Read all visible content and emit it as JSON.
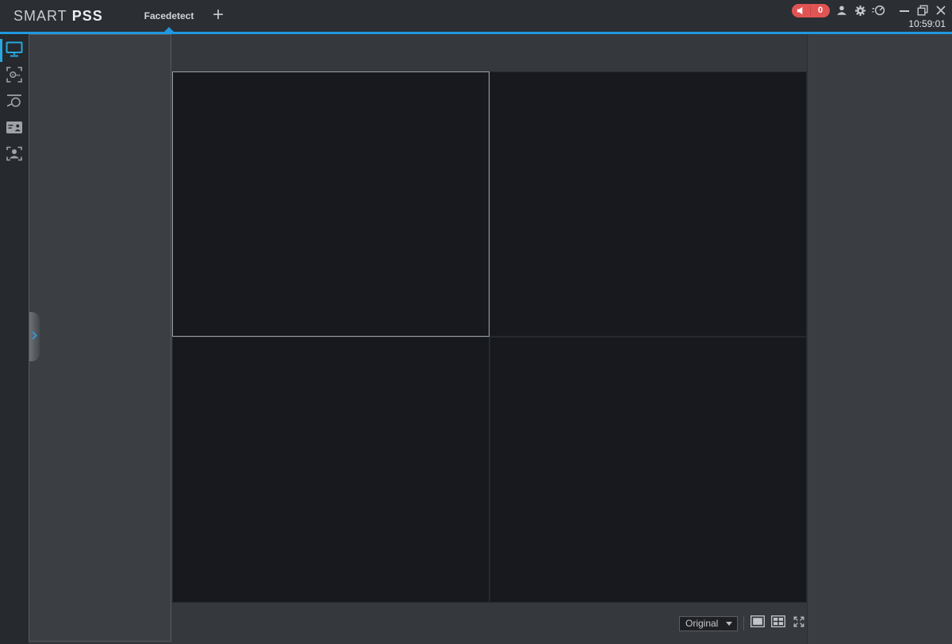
{
  "app": {
    "brand": {
      "part1": "SMART",
      "part2": "PSS"
    },
    "clock": "10:59:01"
  },
  "topbar": {
    "tabs": [
      {
        "label": "Facedetect",
        "active": true
      }
    ],
    "new_tab_label": "+",
    "alarm_badge": {
      "count": "0",
      "icon": "speaker-icon",
      "color": "#e05454"
    },
    "window_icons": [
      "user-icon",
      "settings-gear-icon",
      "netspeed-gauge-icon",
      "minimize-icon",
      "restore-icon",
      "close-icon"
    ]
  },
  "sidebar": {
    "accent_color": "#2aa7e0",
    "items": [
      {
        "name": "live-view",
        "icon": "monitor-icon",
        "active": true
      },
      {
        "name": "face-search",
        "icon": "face-search-icon",
        "active": false
      },
      {
        "name": "record-search",
        "icon": "record-search-icon",
        "active": false
      },
      {
        "name": "person-id",
        "icon": "id-card-icon",
        "active": false
      },
      {
        "name": "face-recognition",
        "icon": "face-recognition-icon",
        "active": false
      }
    ]
  },
  "left_panel": {
    "collapse_handle": {
      "icon": "chevron-right-icon"
    }
  },
  "video_grid": {
    "rows": 2,
    "cols": 2,
    "selected_index": 0,
    "cells": [
      {
        "selected": true
      },
      {
        "selected": false
      },
      {
        "selected": false
      },
      {
        "selected": false
      }
    ]
  },
  "bottom_toolbar": {
    "scale_dropdown": {
      "value": "Original",
      "icon": "caret-down-icon"
    },
    "buttons": [
      {
        "name": "single-view",
        "icon": "single-view-icon"
      },
      {
        "name": "quad-view",
        "icon": "quad-view-icon"
      },
      {
        "name": "fullscreen",
        "icon": "fullscreen-icon"
      }
    ]
  },
  "colors": {
    "accent_blue": "#1f97e0",
    "sidebar_active_blue": "#2aa7e0",
    "alarm_red": "#e05454",
    "topbar_bg": "#2b2e33",
    "sidebar_bg": "#26292d",
    "panel_bg": "#3b3e43",
    "main_bg": "#35383d",
    "video_cell_bg": "#17191e",
    "selected_cell_border": "#9da2a7"
  }
}
